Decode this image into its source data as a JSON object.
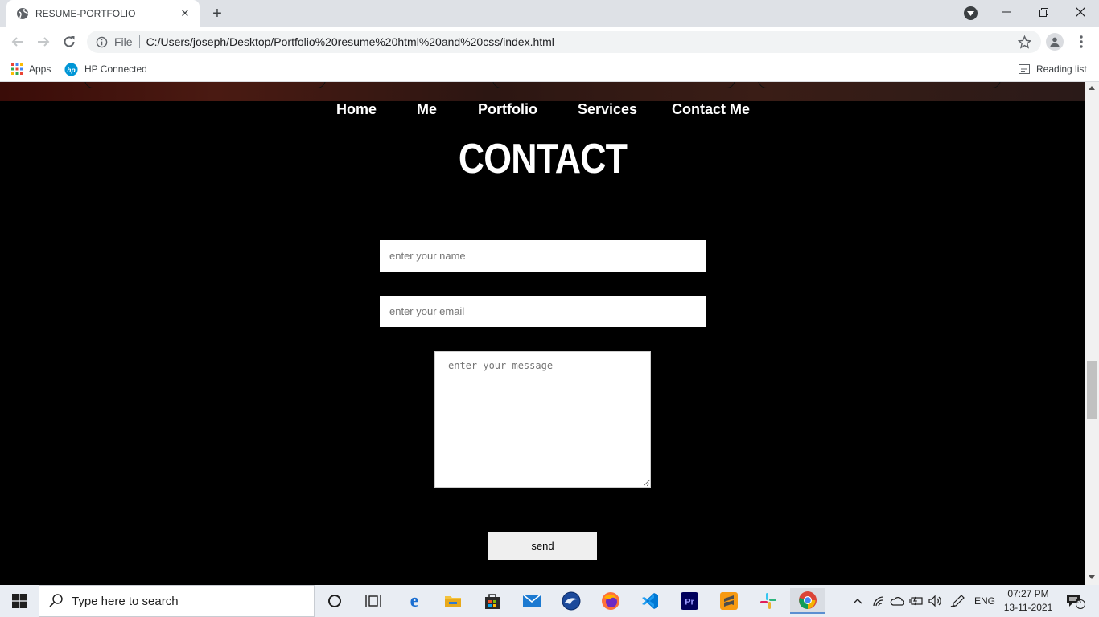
{
  "browser": {
    "tab_title": "RESUME-PORTFOLIO",
    "address_scheme": "File",
    "address_url": "C:/Users/joseph/Desktop/Portfolio%20resume%20html%20and%20css/index.html",
    "bookmarks": [
      {
        "label": "Apps",
        "icon": "apps-grid-icon"
      },
      {
        "label": "HP Connected",
        "icon": "hp-logo-icon"
      }
    ],
    "reading_list_label": "Reading list"
  },
  "page": {
    "nav": [
      "Home",
      "Me",
      "Portfolio",
      "Services",
      "Contact Me"
    ],
    "section_title": "CONTACT",
    "form": {
      "name_placeholder": "enter your name",
      "email_placeholder": "enter your email",
      "message_placeholder": "enter your message",
      "send_label": "send"
    }
  },
  "taskbar": {
    "search_placeholder": "Type here to search",
    "language": "ENG",
    "time": "07:27 PM",
    "date": "13-11-2021",
    "notification_count": "3",
    "pinned_apps": [
      "cortana-icon",
      "task-view-icon",
      "edge-icon",
      "file-explorer-icon",
      "store-icon",
      "mail-icon",
      "thunderbird-icon",
      "firefox-icon",
      "vscode-icon",
      "premiere-pro-icon",
      "sublime-text-icon",
      "slack-icon",
      "chrome-icon"
    ]
  },
  "colors": {
    "page_bg": "#000000",
    "taskbar_bg": "#e9edf3",
    "tabstrip_bg": "#dee1e6"
  }
}
